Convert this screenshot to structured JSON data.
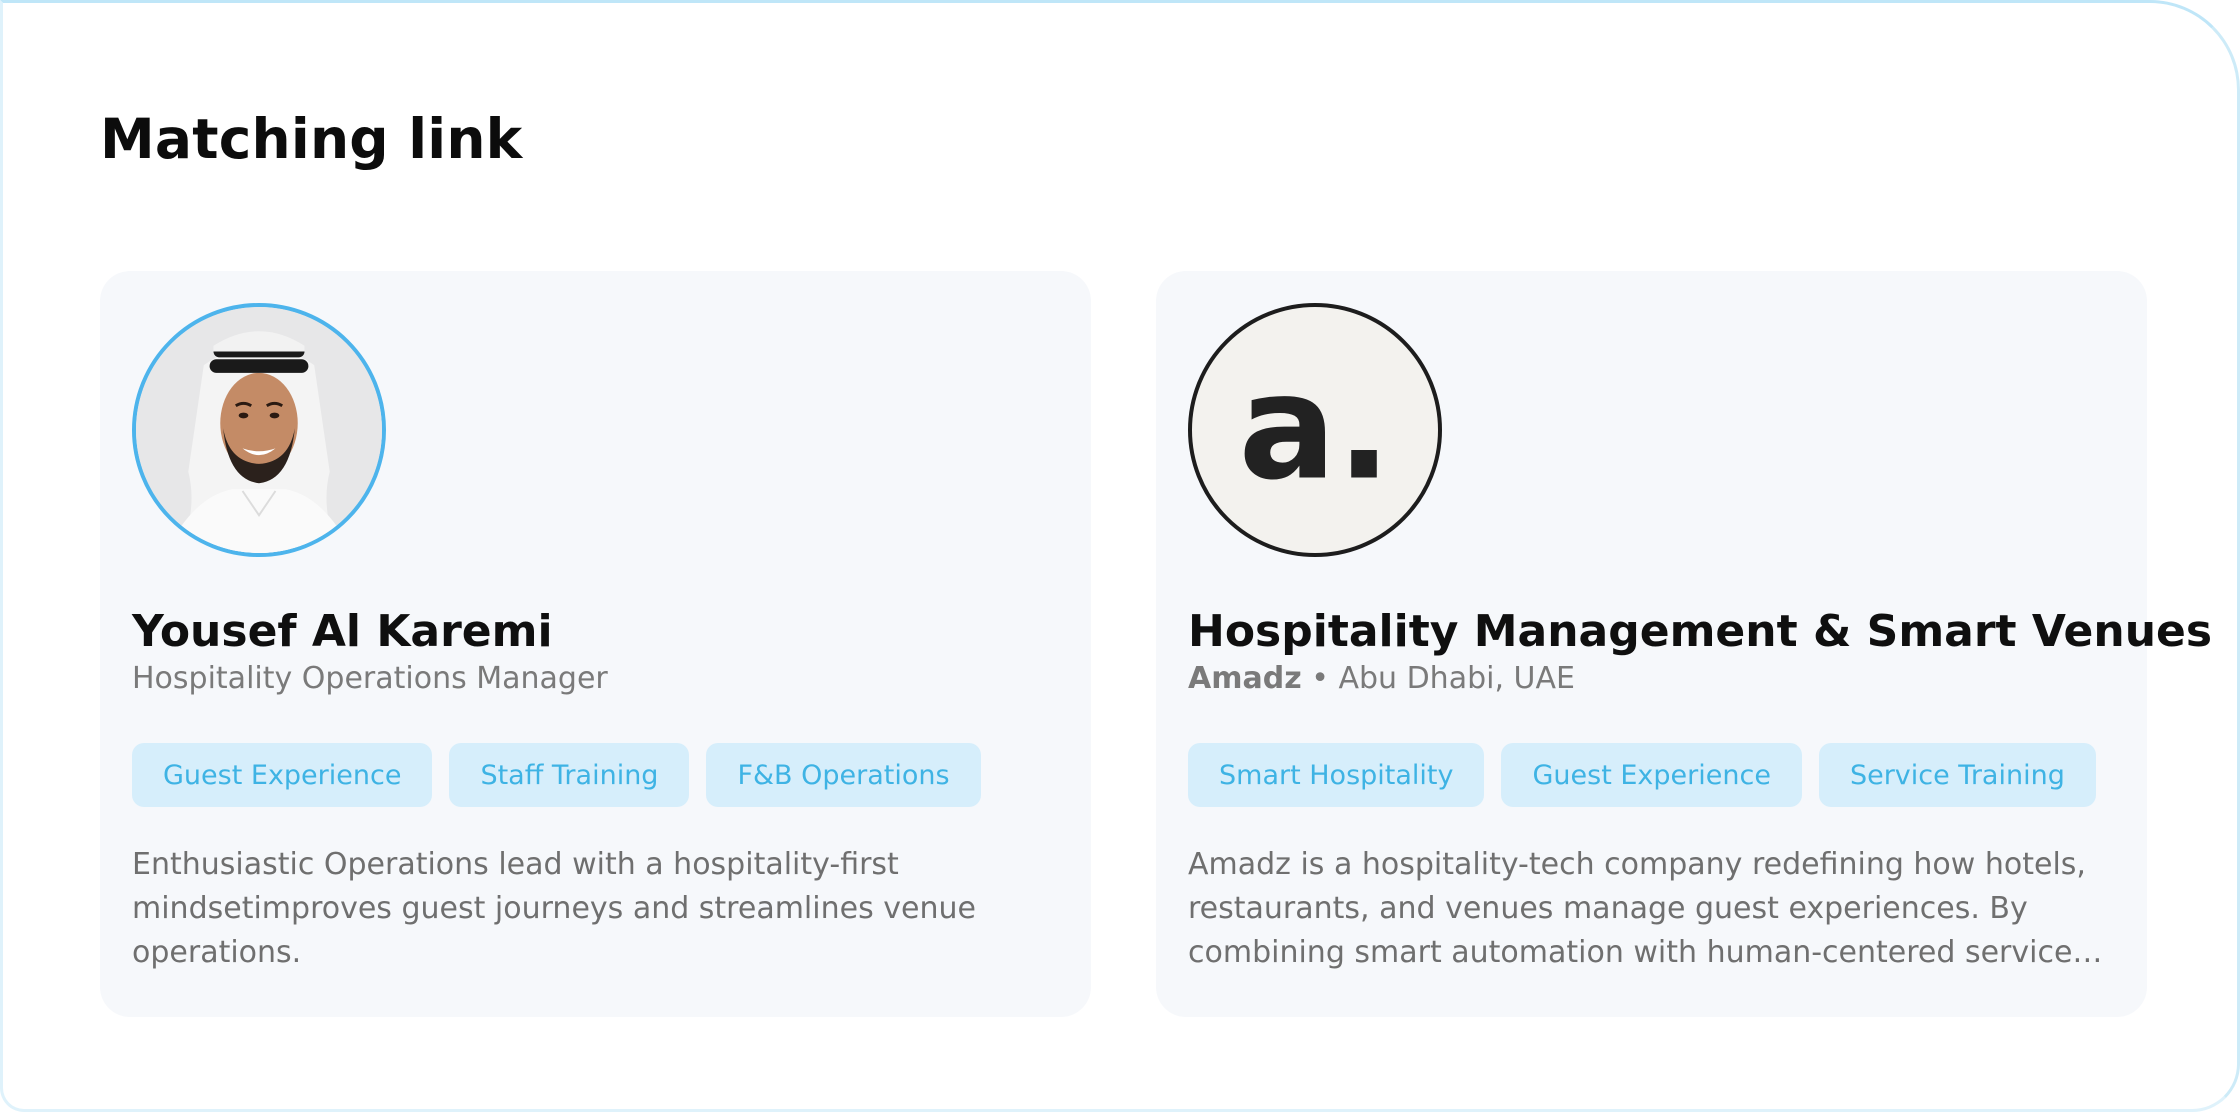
{
  "page": {
    "title": "Matching link"
  },
  "profile_card": {
    "name": "Yousef Al Karemi",
    "role": "Hospitality Operations Manager",
    "tags": [
      "Guest Experience",
      "Staff Training",
      "F&B Operations"
    ],
    "description": "Enthusiastic Operations lead with a hospitality-first mindsetimproves guest journeys and streamlines venue operations.",
    "avatar_icon": "person-photo-icon",
    "avatar_border_color": "#4db4ec"
  },
  "company_card": {
    "title": "Hospitality Management & Smart Venues",
    "company": "Amadz",
    "separator": "•",
    "location": "Abu Dhabi, UAE",
    "tags": [
      "Smart Hospitality",
      "Guest Experience",
      "Service Training"
    ],
    "description": "Amadz is a hospitality-tech company redefining how hotels, restaurants, and venues manage guest experiences. By combining smart automation with human-centered service design.",
    "logo_text": "a.",
    "logo_icon": "company-logo-icon"
  },
  "colors": {
    "tag_background": "#d6eefb",
    "tag_text": "#3eb3e4",
    "card_background": "#f6f8fb"
  }
}
